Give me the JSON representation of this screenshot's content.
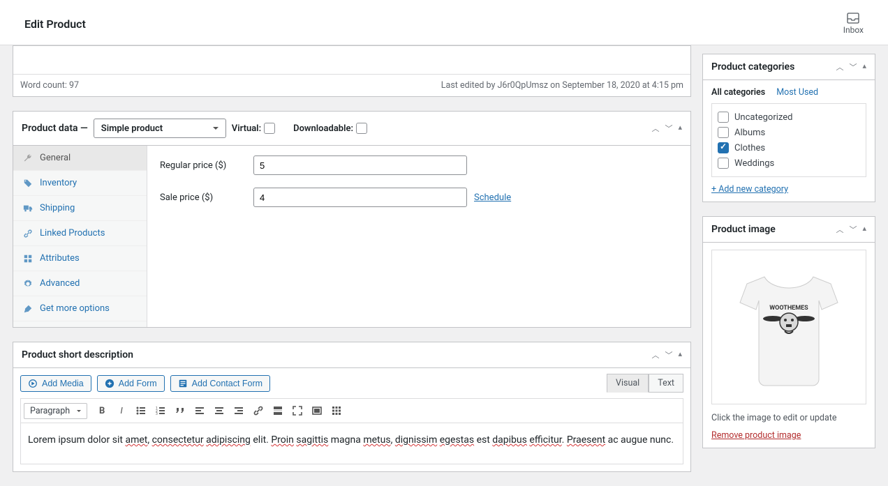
{
  "header": {
    "title": "Edit Product",
    "inbox": "Inbox"
  },
  "wordbar": {
    "count": "Word count: 97",
    "lastedit": "Last edited by J6r0QpUmsz on September 18, 2020 at 4:15 pm"
  },
  "pd": {
    "title": "Product data —",
    "type_sel": "Simple product",
    "virtual": "Virtual:",
    "download": "Downloadable:",
    "tabs": {
      "general": "General",
      "inventory": "Inventory",
      "shipping": "Shipping",
      "linked": "Linked Products",
      "attributes": "Attributes",
      "advanced": "Advanced",
      "more": "Get more options"
    },
    "regprice_label": "Regular price ($)",
    "regprice_val": "5",
    "saleprice_label": "Sale price ($)",
    "saleprice_val": "4",
    "schedule": "Schedule"
  },
  "desc": {
    "title": "Product short description",
    "addmedia": "Add Media",
    "addform": "Add Form",
    "addcontact": "Add Contact Form",
    "visual": "Visual",
    "text": "Text",
    "para": "Paragraph",
    "body_t1": "Lorem ipsum dolor sit ",
    "body_w1": "amet",
    "body_t2": ", ",
    "body_w2": "consectetur",
    "body_t3": " ",
    "body_w3": "adipiscing",
    "body_t4": " elit. ",
    "body_w4": "Proin",
    "body_t5": " ",
    "body_w5": "sagittis",
    "body_t6": " magna ",
    "body_w6": "metus",
    "body_t7": ", ",
    "body_w7": "dignissim",
    "body_t8": " ",
    "body_w8": "egestas",
    "body_t9": " est ",
    "body_w9": "dapibus",
    "body_t10": " ",
    "body_w10": "efficitur",
    "body_t11": ". ",
    "body_w11": "Praesent",
    "body_t12": " ac augue nunc."
  },
  "cats": {
    "title": "Product categories",
    "all": "All categories",
    "most": "Most Used",
    "items": {
      "uncat": "Uncategorized",
      "albums": "Albums",
      "clothes": "Clothes",
      "weddings": "Weddings"
    },
    "add": "+ Add new category"
  },
  "img": {
    "title": "Product image",
    "note": "Click the image to edit or update",
    "remove": "Remove product image",
    "shirt_brand": "WOOTHEMES"
  }
}
